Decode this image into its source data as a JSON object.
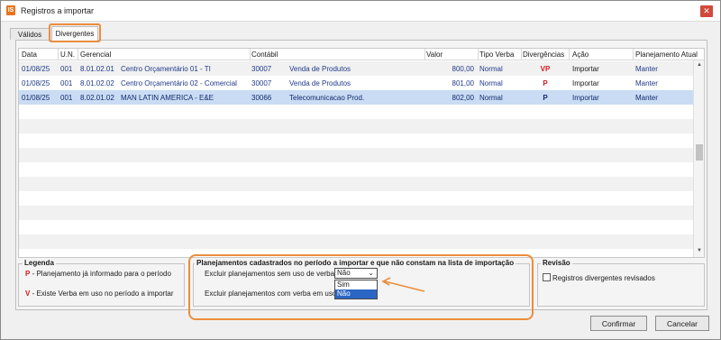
{
  "window": {
    "title": "Registros a importar",
    "icon_label": "IS",
    "close_label": "✕"
  },
  "tabs": [
    {
      "label": "Válidos"
    },
    {
      "label": "Divergentes"
    }
  ],
  "grid": {
    "columns": [
      "Data",
      "U.N.",
      "Gerencial",
      "Contábil",
      "Valor",
      "Tipo Verba",
      "Divergências",
      "Ação",
      "Planejamento Atual"
    ],
    "rows": [
      {
        "data": "01/08/25",
        "un": "001",
        "gerencial_code": "8.01.02.01",
        "gerencial_desc": "Centro Orçamentário 01 - TI",
        "contabil_code": "30007",
        "contabil_desc": "Venda de Produtos",
        "valor": "800,00",
        "tipo_verba": "Normal",
        "divergencias": "VP",
        "acao": "Importar",
        "planejamento": "Manter"
      },
      {
        "data": "01/08/25",
        "un": "001",
        "gerencial_code": "8.01.02.02",
        "gerencial_desc": "Centro Orçamentário 02 - Comercial",
        "contabil_code": "30007",
        "contabil_desc": "Venda de Produtos",
        "valor": "801,00",
        "tipo_verba": "Normal",
        "divergencias": "P",
        "acao": "Importar",
        "planejamento": "Manter"
      },
      {
        "data": "01/08/25",
        "un": "001",
        "gerencial_code": "8.02.01.02",
        "gerencial_desc": "MAN LATIN AMERICA - E&E",
        "contabil_code": "30066",
        "contabil_desc": "Telecomunicacao Prod.",
        "valor": "802,00",
        "tipo_verba": "Normal",
        "divergencias": "P",
        "acao": "Importar",
        "planejamento": "Manter"
      }
    ]
  },
  "legend": {
    "title": "Legenda",
    "items": [
      {
        "code": "P",
        "text": "- Planejamento já informado para o período"
      },
      {
        "code": "V",
        "text": "- Existe Verba em uso no período a importar"
      }
    ]
  },
  "planejamentos": {
    "title": "Planejamentos cadastrados no período a importar e que não constam na lista de importação",
    "q1_label": "Excluir planejamentos sem uso de verba?",
    "q1_value": "Não",
    "q2_label": "Excluir planejamentos com verba em uso?",
    "dropdown_options": [
      "Sim",
      "Não"
    ]
  },
  "revisao": {
    "title": "Revisão",
    "checkbox_label": "Registros divergentes revisados",
    "checked": false
  },
  "buttons": {
    "confirm": "Confirmar",
    "cancel": "Cancelar"
  },
  "colors": {
    "accent_orange": "#ec8d3c",
    "selected_row": "#c9dcf3",
    "divergence_red": "#d21c1c",
    "dropdown_selected": "#2b66c4"
  }
}
